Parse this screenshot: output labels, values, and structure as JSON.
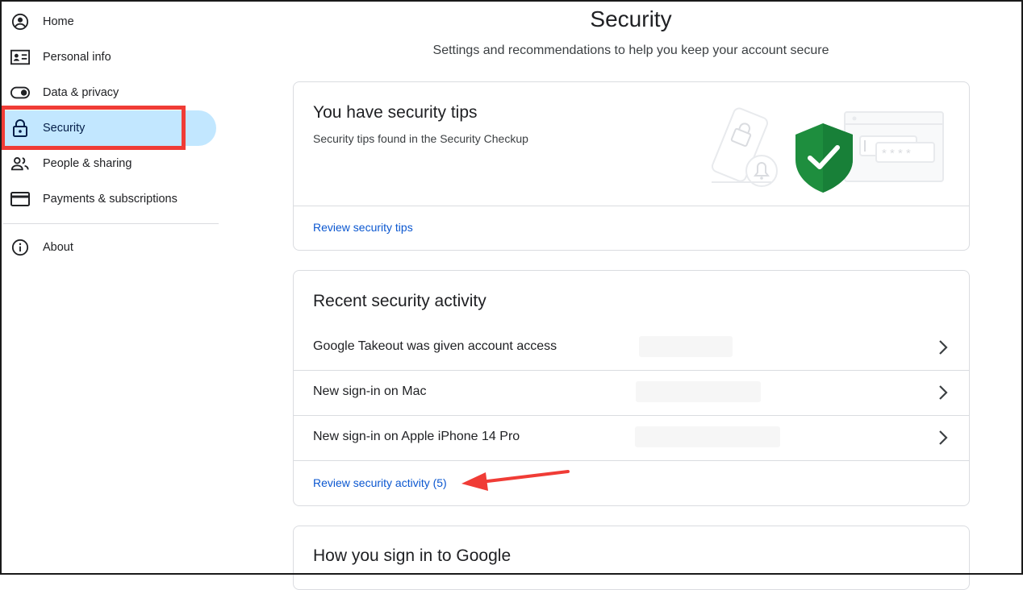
{
  "sidebar": {
    "items": [
      {
        "label": "Home",
        "icon": "account-circle-icon"
      },
      {
        "label": "Personal info",
        "icon": "id-card-icon"
      },
      {
        "label": "Data & privacy",
        "icon": "toggle-icon"
      },
      {
        "label": "Security",
        "icon": "lock-icon",
        "active": true
      },
      {
        "label": "People & sharing",
        "icon": "people-icon"
      },
      {
        "label": "Payments & subscriptions",
        "icon": "credit-card-icon"
      }
    ],
    "about": {
      "label": "About",
      "icon": "info-icon"
    }
  },
  "header": {
    "title": "Security",
    "subtitle": "Settings and recommendations to help you keep your account secure"
  },
  "tips_card": {
    "title": "You have security tips",
    "description": "Security tips found in the Security Checkup",
    "link": "Review security tips",
    "illustration_password_mask": "* * * *"
  },
  "activity_card": {
    "title": "Recent security activity",
    "rows": [
      {
        "text": "Google Takeout was given account access"
      },
      {
        "text": "New sign-in on Mac"
      },
      {
        "text": "New sign-in on Apple iPhone 14 Pro"
      }
    ],
    "link": "Review security activity (5)"
  },
  "signin_card": {
    "title": "How you sign in to Google"
  },
  "colors": {
    "accent_link": "#0b57d0",
    "active_nav_bg": "#c2e7ff",
    "highlight_red": "#f03c36",
    "shield_green": "#1e8e3e"
  }
}
